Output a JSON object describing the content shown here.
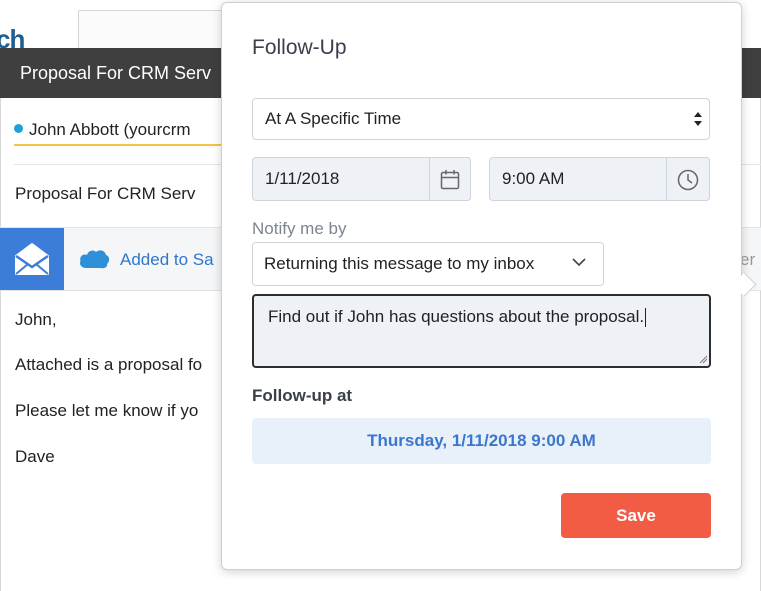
{
  "background": {
    "logo_fragment": "ch",
    "window_title": "Proposal For CRM Serv",
    "recipient": "John Abbott (yourcrm",
    "subject": "Proposal For CRM Serv",
    "addon_status": "Added to Sa",
    "addon_edge_fragment": "er",
    "body_lines": [
      "John,",
      "Attached is a proposal fo",
      "Please let me know if yo",
      "Dave"
    ],
    "colors": {
      "titlebar": "#3f3f3f",
      "addon_button": "#3b7dd8",
      "recipient_underline": "#f4c542"
    }
  },
  "followup": {
    "title": "Follow-Up",
    "timing_select": "At A Specific Time",
    "date_value": "1/11/2018",
    "time_value": "9:00 AM",
    "notify_label": "Notify me by",
    "notify_select": "Returning this message to my inbox",
    "note_text": "Find out if John has questions about the proposal.",
    "followup_at_label": "Follow-up at",
    "followup_at_value": "Thursday, 1/11/2018 9:00 AM",
    "save_label": "Save",
    "icons": {
      "date": "calendar-icon",
      "time": "clock-icon",
      "notify": "chevron-down-icon",
      "timing": "select-arrows-icon"
    },
    "colors": {
      "save": "#f25b44",
      "followup_value": "#3b77cc",
      "followup_value_bg": "#e8f0fa"
    }
  }
}
